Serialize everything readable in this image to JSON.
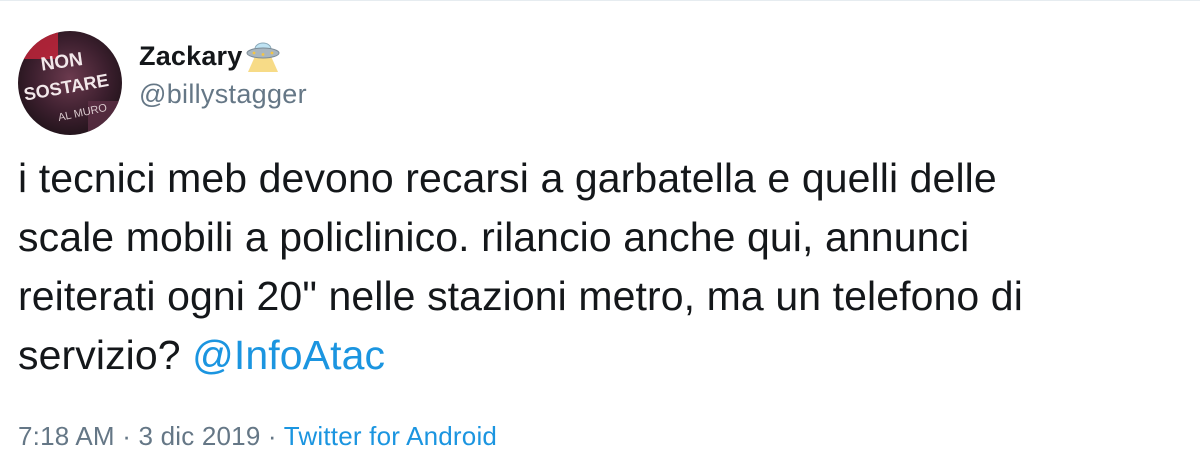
{
  "user": {
    "display_name": "Zackary",
    "handle": "@billystagger",
    "avatar_text": [
      "NON",
      "SOSTARE",
      "AL MURO"
    ],
    "name_emoji": "flying-saucer-icon"
  },
  "tweet": {
    "text_lines": [
      "i tecnici meb devono recarsi a garbatella e quelli delle",
      "scale mobili a policlinico. rilancio anche qui, annunci",
      "reiterati ogni 20\" nelle stazioni metro, ma un telefono di",
      "servizio? "
    ],
    "mention": "@InfoAtac"
  },
  "meta": {
    "time": "7:18 AM",
    "separator": " · ",
    "date": "3 dic 2019",
    "source": "Twitter for Android"
  },
  "colors": {
    "text": "#14171a",
    "secondary": "#657786",
    "link": "#1b95e0"
  }
}
